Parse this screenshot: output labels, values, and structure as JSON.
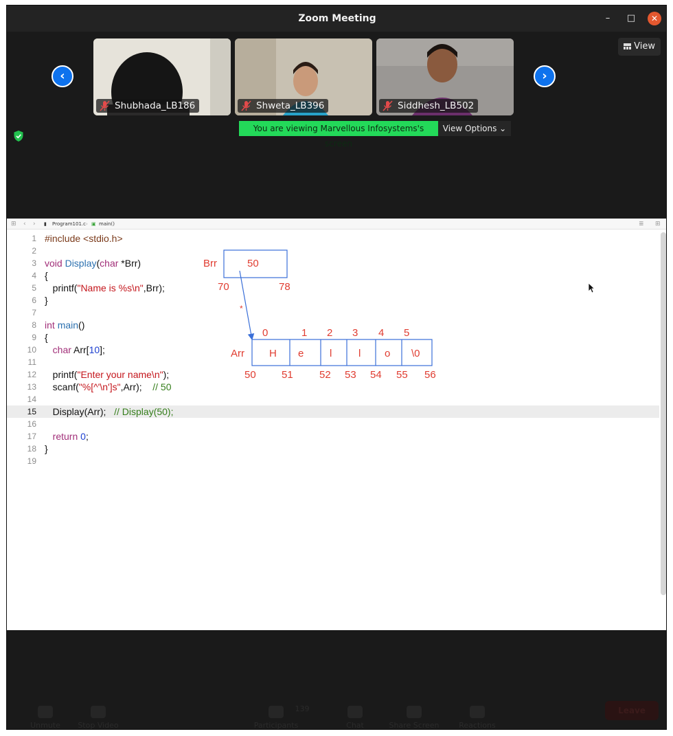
{
  "window": {
    "title": "Zoom Meeting",
    "minimize": "–",
    "maximize": "□",
    "close": "✕"
  },
  "gallery": {
    "view_label": "View",
    "participants": [
      {
        "name": "Shubhada_LB186",
        "muted": true
      },
      {
        "name": "Shweta_LB396",
        "muted": true
      },
      {
        "name": "Siddhesh_LB502",
        "muted": true
      }
    ],
    "prev_arrow": "‹",
    "next_arrow": "›",
    "viewing_banner": "You are viewing Marvellous Infosystems's screen",
    "view_options": "View Options ⌄"
  },
  "editor": {
    "breadcrumb": {
      "file": "Program101.c",
      "symbol": "main()"
    },
    "current_line": 15,
    "lines": [
      {
        "no": "1",
        "html": "<span class=\"pp\">#include &lt;stdio.h&gt;</span>"
      },
      {
        "no": "2",
        "html": ""
      },
      {
        "no": "3",
        "html": "<span class=\"k\">void</span> <span class=\"f\">Display</span>(<span class=\"k\">char</span> *Brr)"
      },
      {
        "no": "4",
        "html": "{"
      },
      {
        "no": "5",
        "html": "   printf(<span class=\"s\">\"Name is %s\\n\"</span>,Brr);"
      },
      {
        "no": "6",
        "html": "}"
      },
      {
        "no": "7",
        "html": ""
      },
      {
        "no": "8",
        "html": "<span class=\"k\">int</span> <span class=\"f\">main</span>()"
      },
      {
        "no": "9",
        "html": "{"
      },
      {
        "no": "10",
        "html": "   <span class=\"k\">char</span> Arr[<span class=\"n\">10</span>];"
      },
      {
        "no": "11",
        "html": ""
      },
      {
        "no": "12",
        "html": "   printf(<span class=\"s\">\"Enter your name\\n\"</span>);"
      },
      {
        "no": "13",
        "html": "   scanf(<span class=\"s\">\"%[^'\\n']s\"</span>,Arr);    <span class=\"c\">// 50</span>"
      },
      {
        "no": "14",
        "html": ""
      },
      {
        "no": "15",
        "html": "   Display(Arr);   <span class=\"c\">// Display(50);</span>"
      },
      {
        "no": "16",
        "html": ""
      },
      {
        "no": "17",
        "html": "   <span class=\"k\">return</span> <span class=\"n\">0</span>;"
      },
      {
        "no": "18",
        "html": "}"
      },
      {
        "no": "19",
        "html": ""
      }
    ]
  },
  "diagram": {
    "pointer": {
      "name": "Brr",
      "value": "50",
      "addr_start": "70",
      "addr_end": "78",
      "star": "*"
    },
    "array": {
      "name": "Arr",
      "indices": [
        "0",
        "1",
        "2",
        "3",
        "4",
        "5"
      ],
      "cells": [
        "H",
        "e",
        "l",
        "l",
        "o",
        "\\0"
      ],
      "addresses": [
        "50",
        "51",
        "52",
        "53",
        "54",
        "55",
        "56"
      ]
    },
    "colors": {
      "ink": "#e03c30",
      "box": "#3a6fd8"
    }
  },
  "controls": {
    "items": [
      "Unmute",
      "Stop Video",
      "Participants",
      "Chat",
      "Share Screen",
      "Reactions"
    ],
    "participants_count": "139",
    "leave": "Leave"
  }
}
